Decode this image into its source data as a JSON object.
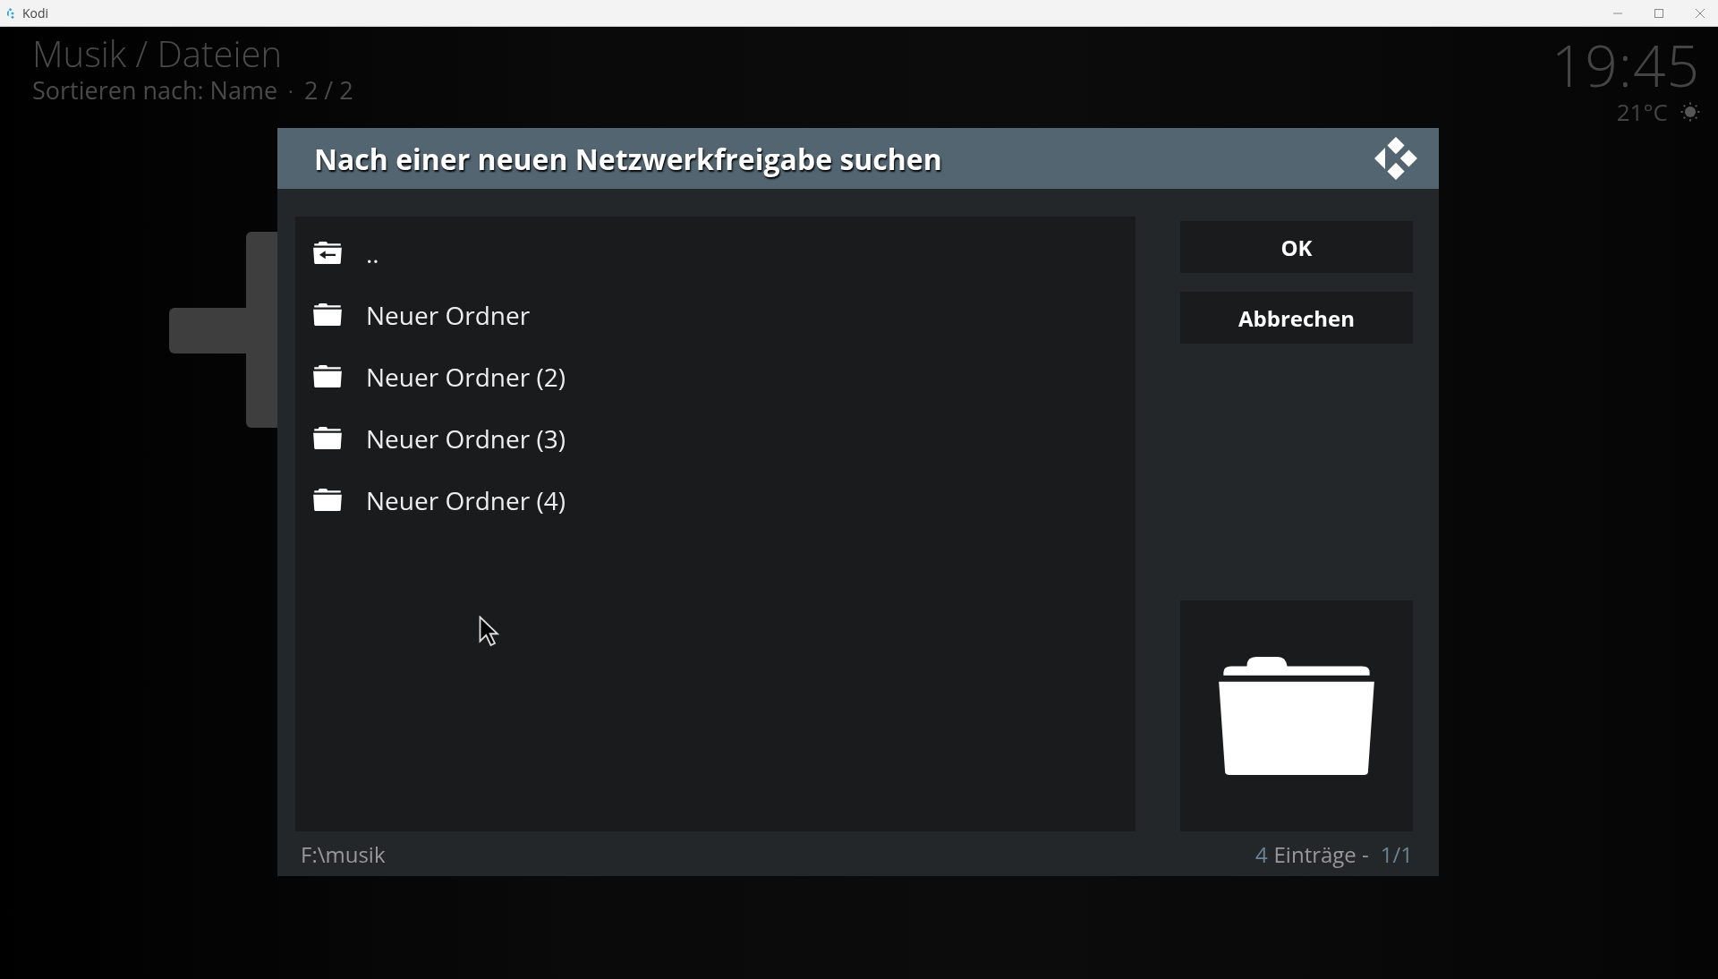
{
  "window": {
    "title": "Kodi"
  },
  "header": {
    "title": "Musik / Dateien",
    "subtitle": "Sortieren nach: Name",
    "separator": "·",
    "position": "2 / 2"
  },
  "clock": {
    "time": "19:45",
    "temperature": "21°C"
  },
  "dialog": {
    "title": "Nach einer neuen Netzwerkfreigabe suchen",
    "items": [
      {
        "kind": "parent",
        "label": "..",
        "selected": false
      },
      {
        "kind": "folder",
        "label": "Neuer Ordner",
        "selected": false
      },
      {
        "kind": "folder",
        "label": "Neuer Ordner (2)",
        "selected": false
      },
      {
        "kind": "folder",
        "label": "Neuer Ordner (3)",
        "selected": false
      },
      {
        "kind": "folder",
        "label": "Neuer Ordner (4)",
        "selected": false
      }
    ],
    "buttons": [
      "OK",
      "Abbrechen"
    ],
    "path": "F:\\musik",
    "count": "4",
    "count_label": "Einträge - ",
    "page": "1/1"
  }
}
